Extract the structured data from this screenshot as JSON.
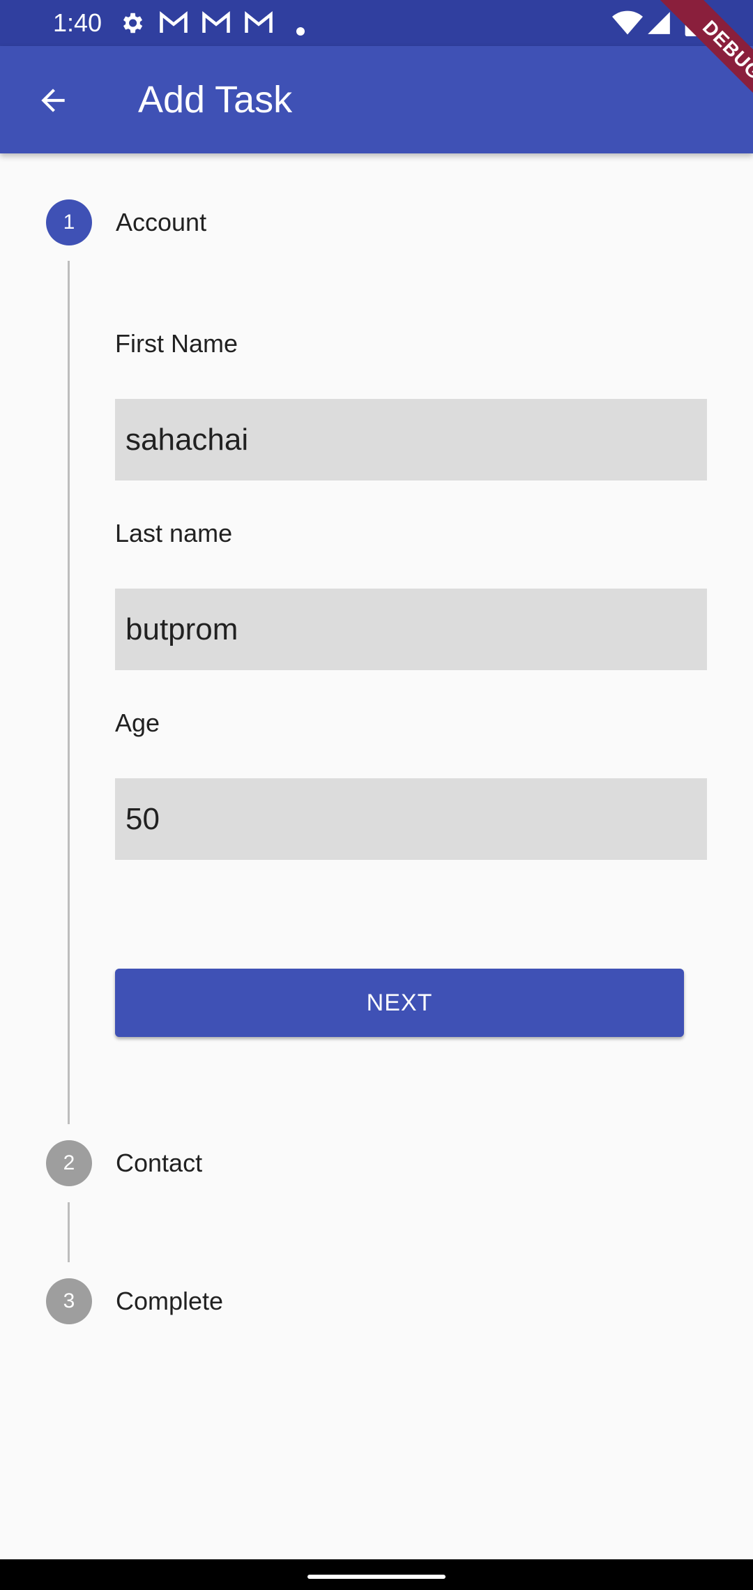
{
  "status_bar": {
    "time": "1:40",
    "icons": [
      "gear-icon",
      "gmail-icon",
      "gmail-icon",
      "gmail-icon",
      "dot-icon",
      "wifi-icon",
      "signal-icon",
      "battery-icon"
    ]
  },
  "app_bar": {
    "title": "Add Task",
    "back_icon": "arrow-back-icon"
  },
  "debug_banner": "DEBUG",
  "stepper": {
    "steps": [
      {
        "number": "1",
        "title": "Account",
        "state": "active"
      },
      {
        "number": "2",
        "title": "Contact",
        "state": "inactive"
      },
      {
        "number": "3",
        "title": "Complete",
        "state": "inactive"
      }
    ],
    "form": {
      "first_name": {
        "label": "First Name",
        "value": "sahachai"
      },
      "last_name": {
        "label": "Last name",
        "value": "butprom"
      },
      "age": {
        "label": "Age",
        "value": "50"
      }
    },
    "next_label": "NEXT"
  },
  "colors": {
    "primary": "#3f51b5",
    "primary_dark": "#303f9f",
    "inactive_step": "#9e9e9e",
    "input_fill": "#dcdcdc",
    "debug_banner": "#8a1f3c"
  }
}
